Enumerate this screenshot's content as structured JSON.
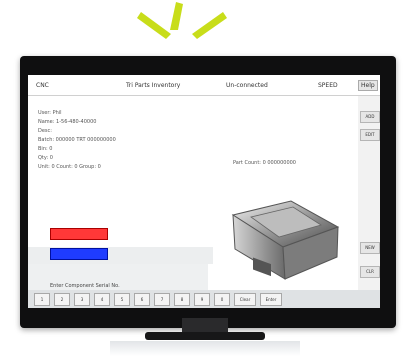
{
  "topbar": {
    "left_label": "CNC",
    "center_label": "Tri Parts Inventory",
    "right_label": "Un-connected",
    "status_label": "SPEED",
    "button_label": "Help"
  },
  "info": {
    "lines": [
      "User: Phil",
      "Name: 1-56-480-40000",
      "Desc: ",
      "Batch: 000000 TRT 000000000",
      "Bin: 0",
      "Qty: 0",
      "Unit: 0    Count: 0    Group: 0"
    ],
    "middle_label": "Part Count: 0  000000000"
  },
  "side_buttons": [
    "ADD",
    "EDIT",
    "NEW",
    "CLR"
  ],
  "status": "Enter Component Serial No.",
  "keypad": [
    "1",
    "2",
    "3",
    "4",
    "5",
    "6",
    "7",
    "8",
    "9",
    "0",
    "Clear",
    "Enter"
  ],
  "colors": {
    "red_button": "#ff3838",
    "blue_button": "#1f3cff",
    "glow": "#c8dd1a"
  },
  "icons": {
    "glow": "sun-rays-icon",
    "product": "cnc-part-photo"
  }
}
